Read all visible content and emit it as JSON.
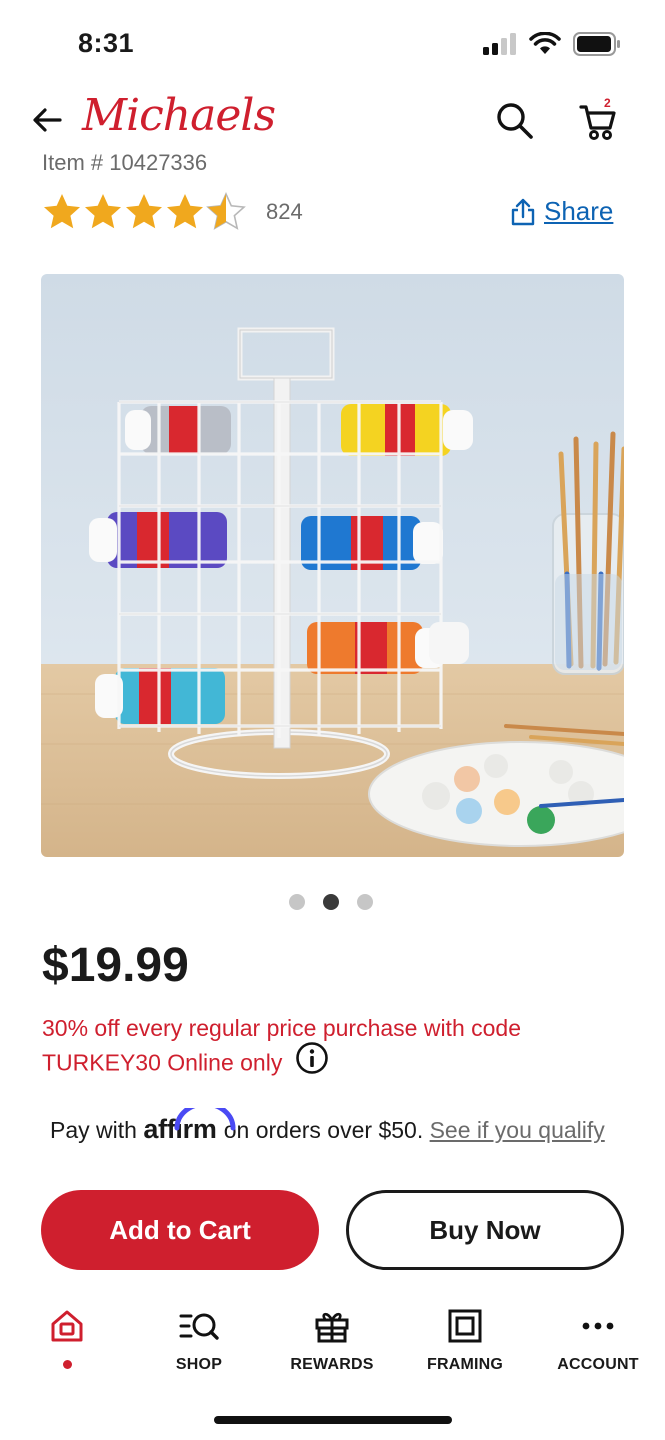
{
  "status_bar": {
    "time": "8:31"
  },
  "nav": {
    "logo_text": "Michaels",
    "cart_count": "2"
  },
  "product": {
    "item_number": "Item # 10427336",
    "rating": 4.5,
    "review_count": "824",
    "share_label": "Share",
    "image_count": 3,
    "image_index": 2,
    "price": "$19.99",
    "promo_text": "30% off every regular price purchase with code TURKEY30 Online only",
    "affirm_prefix": "Pay with",
    "affirm_brand": "affirm",
    "affirm_suffix": "on orders over $50.",
    "affirm_link": "See if you qualify"
  },
  "actions": {
    "add_to_cart": "Add to Cart",
    "buy_now": "Buy Now"
  },
  "tabbar": {
    "items": [
      {
        "label": "",
        "icon": "home-icon",
        "active": true
      },
      {
        "label": "SHOP",
        "icon": "shop-search-icon"
      },
      {
        "label": "REWARDS",
        "icon": "gift-icon"
      },
      {
        "label": "FRAMING",
        "icon": "frame-icon"
      },
      {
        "label": "ACCOUNT",
        "icon": "more-icon"
      }
    ]
  },
  "colors": {
    "brand_red": "#cf1f2e",
    "link_blue": "#0d63b3",
    "star_gold": "#f0a81e"
  }
}
